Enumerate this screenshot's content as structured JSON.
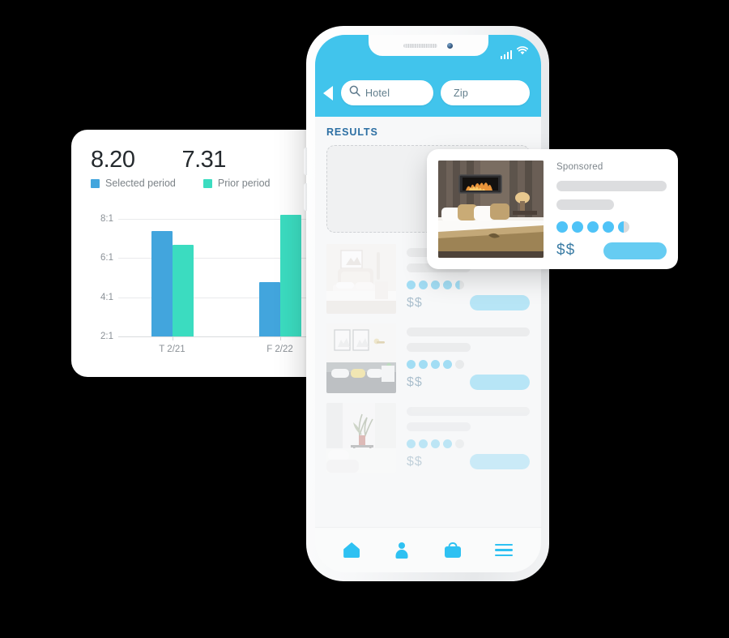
{
  "chart_card": {
    "kpis": [
      {
        "value": "8.20",
        "legend": "Selected period",
        "color": "#42a5dd"
      },
      {
        "value": "7.31",
        "legend": "Prior period",
        "color": "#3bdcc0"
      }
    ],
    "chart_data": {
      "type": "bar",
      "title": "",
      "xlabel": "",
      "ylabel": "",
      "categories": [
        "T 2/21",
        "F 2/22"
      ],
      "ytick_labels": [
        "2:1",
        "4:1",
        "6:1",
        "8:1"
      ],
      "ytick_values": [
        2,
        4,
        6,
        8
      ],
      "ylim": [
        2,
        8.6
      ],
      "grid": true,
      "legend_position": "top-left",
      "series": [
        {
          "name": "Selected period",
          "color": "#42a5dd",
          "values": [
            7.4,
            4.8
          ]
        },
        {
          "name": "Prior period",
          "color": "#3bdcc0",
          "values": [
            6.7,
            8.2
          ]
        }
      ]
    }
  },
  "phone": {
    "status": {
      "signal_icon": "signal-bars-icon",
      "wifi_icon": "wifi-icon"
    },
    "header": {
      "back_icon": "back-arrow-icon",
      "search_icon": "search-icon",
      "search_value": "Hotel",
      "zip_value": "Zip"
    },
    "results_title": "RESULTS",
    "results": [
      {
        "rating": 4.5,
        "rating_max": 5,
        "price": "$$",
        "cta": ""
      },
      {
        "rating": 4,
        "rating_max": 5,
        "price": "$$",
        "cta": ""
      },
      {
        "rating": 3.5,
        "rating_max": 5,
        "price": "$$",
        "cta": ""
      }
    ],
    "bottom_nav": [
      {
        "icon": "home-icon"
      },
      {
        "icon": "person-icon"
      },
      {
        "icon": "bag-icon"
      },
      {
        "icon": "hamburger-menu-icon"
      }
    ]
  },
  "sponsored_card": {
    "label": "Sponsored",
    "rating": 4.5,
    "rating_max": 5,
    "price": "$$",
    "image_alt": "hotel-room-photo"
  },
  "colors": {
    "brand_blue": "#41c4ec",
    "series_blue": "#42a5dd",
    "series_teal": "#3bdcc0",
    "results_heading": "#2c6fa3",
    "dot_blue": "#4fc3f7",
    "background": "#000000"
  }
}
